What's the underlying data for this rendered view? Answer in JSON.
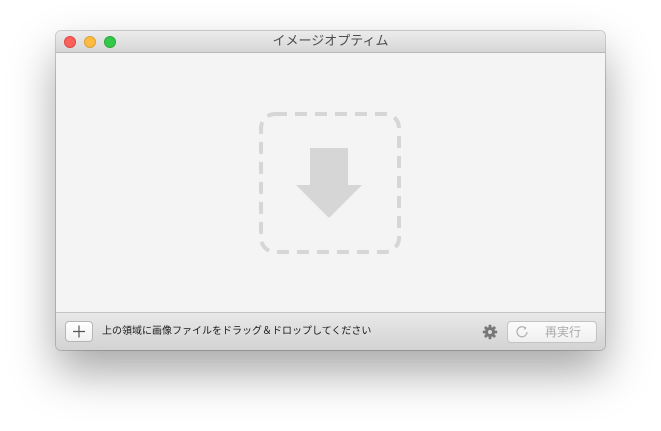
{
  "window": {
    "title": "イメージオプティム"
  },
  "dropzone": {
    "icon": "download-arrow-icon"
  },
  "bottombar": {
    "add_icon": "plus-icon",
    "hint": "上の領域に画像ファイルをドラッグ＆ドロップしてください",
    "settings_icon": "gear-icon",
    "rerun_icon": "refresh-icon",
    "rerun_label": "再実行"
  },
  "colors": {
    "close": "#fc605c",
    "minimize": "#fdbc40",
    "maximize": "#34c84a",
    "dropzone_outline": "#d6d6d6",
    "disabled_text": "#a9a9a9"
  }
}
